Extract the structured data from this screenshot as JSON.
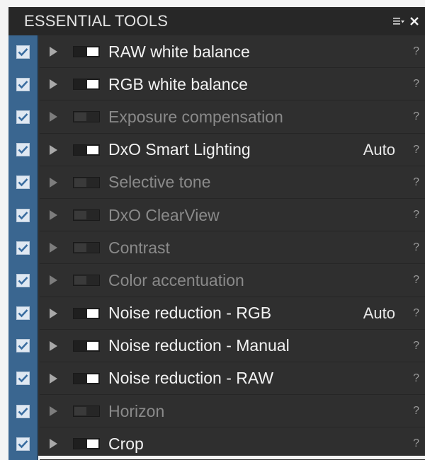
{
  "header": {
    "title": "ESSENTIAL TOOLS",
    "menu_icon": "menu-dropdown-icon",
    "close_icon": "close-icon"
  },
  "colors": {
    "panel_bg": "#2f2f2f",
    "check_column": "#3a6690",
    "enabled_text": "#f2f2f2",
    "disabled_text": "#8a8a8a"
  },
  "tools": [
    {
      "label": "RAW white balance",
      "checked": true,
      "enabled": true,
      "value": "",
      "help": "?"
    },
    {
      "label": "RGB white balance",
      "checked": true,
      "enabled": true,
      "value": "",
      "help": "?"
    },
    {
      "label": "Exposure compensation",
      "checked": true,
      "enabled": false,
      "value": "",
      "help": "?"
    },
    {
      "label": "DxO Smart Lighting",
      "checked": true,
      "enabled": true,
      "value": "Auto",
      "help": "?"
    },
    {
      "label": "Selective tone",
      "checked": true,
      "enabled": false,
      "value": "",
      "help": "?"
    },
    {
      "label": "DxO ClearView",
      "checked": true,
      "enabled": false,
      "value": "",
      "help": "?"
    },
    {
      "label": "Contrast",
      "checked": true,
      "enabled": false,
      "value": "",
      "help": "?"
    },
    {
      "label": "Color accentuation",
      "checked": true,
      "enabled": false,
      "value": "",
      "help": "?"
    },
    {
      "label": "Noise reduction - RGB",
      "checked": true,
      "enabled": true,
      "value": "Auto",
      "help": "?"
    },
    {
      "label": "Noise reduction - Manual",
      "checked": true,
      "enabled": true,
      "value": "",
      "help": "?"
    },
    {
      "label": "Noise reduction - RAW",
      "checked": true,
      "enabled": true,
      "value": "",
      "help": "?"
    },
    {
      "label": "Horizon",
      "checked": true,
      "enabled": false,
      "value": "",
      "help": "?"
    },
    {
      "label": "Crop",
      "checked": true,
      "enabled": true,
      "value": "",
      "help": "?"
    }
  ]
}
